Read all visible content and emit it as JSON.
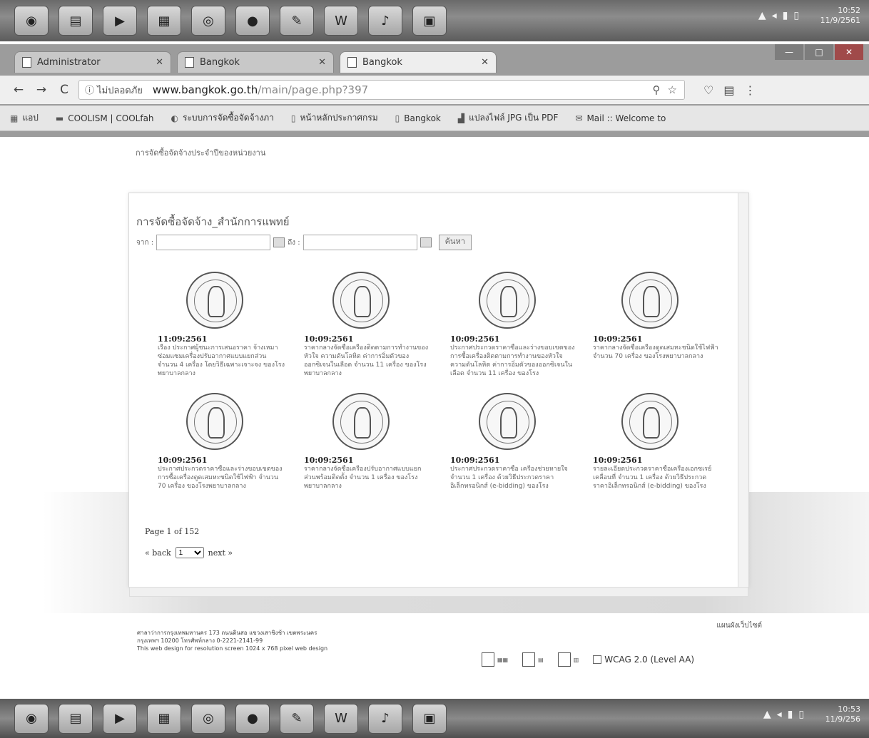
{
  "taskbar_top": {
    "icons": [
      "start-orb",
      "explorer",
      "media-player",
      "notes",
      "chrome",
      "line",
      "chat",
      "word",
      "acrobat",
      "folder"
    ],
    "clock_time": "10:52",
    "clock_date": "11/9/2561"
  },
  "taskbar_bottom": {
    "clock_time": "10:53",
    "clock_date": "11/9/256"
  },
  "tabs": [
    {
      "label": "Administrator",
      "active": false
    },
    {
      "label": "Bangkok",
      "active": false
    },
    {
      "label": "Bangkok",
      "active": true
    }
  ],
  "address": {
    "secure_label": "ไม่ปลอดภัย",
    "host": "www.bangkok.go.th",
    "path": "/main/page.php?397"
  },
  "bookmarks": [
    {
      "icon": "apps-icon",
      "label": "แอป"
    },
    {
      "icon": "bookmark-icon",
      "label": "COOLISM | COOLfah"
    },
    {
      "icon": "bookmark-icon",
      "label": "ระบบการจัดซื้อจัดจ้างภา"
    },
    {
      "icon": "page-icon",
      "label": "หน้าหลักประกาศกรม"
    },
    {
      "icon": "page-icon",
      "label": "Bangkok"
    },
    {
      "icon": "pdf-icon",
      "label": "แปลงไฟล์ JPG เป็น PDF"
    },
    {
      "icon": "mail-icon",
      "label": "Mail :: Welcome to"
    }
  ],
  "breadcrumb": "การจัดซื้อจัดจ้างประจำปีของหน่วยงาน",
  "panel": {
    "title": "การจัดซื้อจัดจ้าง_สำนักการแพทย์",
    "from_label": "จาก :",
    "to_label": "ถึง :",
    "search_label": "ค้นหา"
  },
  "cards": [
    {
      "date": "11:09:2561",
      "desc": "เรื่อง ประกาศผู้ชนะการเสนอราคา จ้างเหมาซ่อมแซมเครื่องปรับอากาศแบบแยกส่วน จำนวน 4 เครื่อง โดยวิธีเฉพาะเจาะจง ของโรงพยาบาลกลาง"
    },
    {
      "date": "10:09:2561",
      "desc": "ราคากลางจัดซื้อเครื่องติดตามการทำงานของหัวใจ ความดันโลหิต ค่าการอิ่มตัวของออกซิเจนในเลือด จำนวน 11 เครื่อง ของโรงพยาบาลกลาง"
    },
    {
      "date": "10:09:2561",
      "desc": "ประกาศประกวดราคาซื้อและร่างขอบเขตของการซื้อเครื่องติดตามการทำงานของหัวใจ ความดันโลหิต ค่าการอิ่มตัวของออกซิเจนในเลือด จำนวน 11 เครื่อง ของโรง"
    },
    {
      "date": "10:09:2561",
      "desc": "ราคากลางจัดซื้อเครื่องดูดเสมหะชนิดใช้ไฟฟ้า จำนวน 70 เครื่อง ของโรงพยาบาลกลาง"
    },
    {
      "date": "10:09:2561",
      "desc": "ประกาศประกวดราคาซื้อและร่างขอบเขตของการซื้อเครื่องดูดเสมหะชนิดใช้ไฟฟ้า จำนวน 70 เครื่อง ของโรงพยาบาลกลาง"
    },
    {
      "date": "10:09:2561",
      "desc": "ราคากลางจัดซื้อเครื่องปรับอากาศแบบแยกส่วนพร้อมติดตั้ง จำนวน 1 เครื่อง ของโรงพยาบาลกลาง"
    },
    {
      "date": "10:09:2561",
      "desc": "ประกาศประกวดราคาซื้อ เครื่องช่วยหายใจ จำนวน 1 เครื่อง ด้วยวิธีประกวดราคาอิเล็กทรอนิกส์ (e-bidding) ของโรง"
    },
    {
      "date": "10:09:2561",
      "desc": "รายละเอียดประกวดราคาซื้อเครื่องเอกซเรย์เคลื่อนที่ จำนวน 1 เครื่อง ด้วยวิธีประกวดราคาอิเล็กทรอนิกส์ (e-bidding) ของโรง"
    }
  ],
  "pager": {
    "page_word": "Page",
    "current": "1",
    "of_word": "of",
    "total": "152",
    "back": "« back",
    "next": "next »",
    "select_value": "1"
  },
  "footer": {
    "lines": [
      "ศาลาว่าการกรุงเทพมหานคร 173 ถนนดินสอ แขวงเสาชิงช้า เขตพระนคร",
      "กรุงเทพฯ 10200 โทรศัพท์กลาง 0-2221-2141-99",
      "This web design for resolution screen 1024 x 768 pixel web design"
    ],
    "right_link": "แผนผังเว็บไซต์",
    "wcag": "WCAG 2.0 (Level AA)"
  }
}
